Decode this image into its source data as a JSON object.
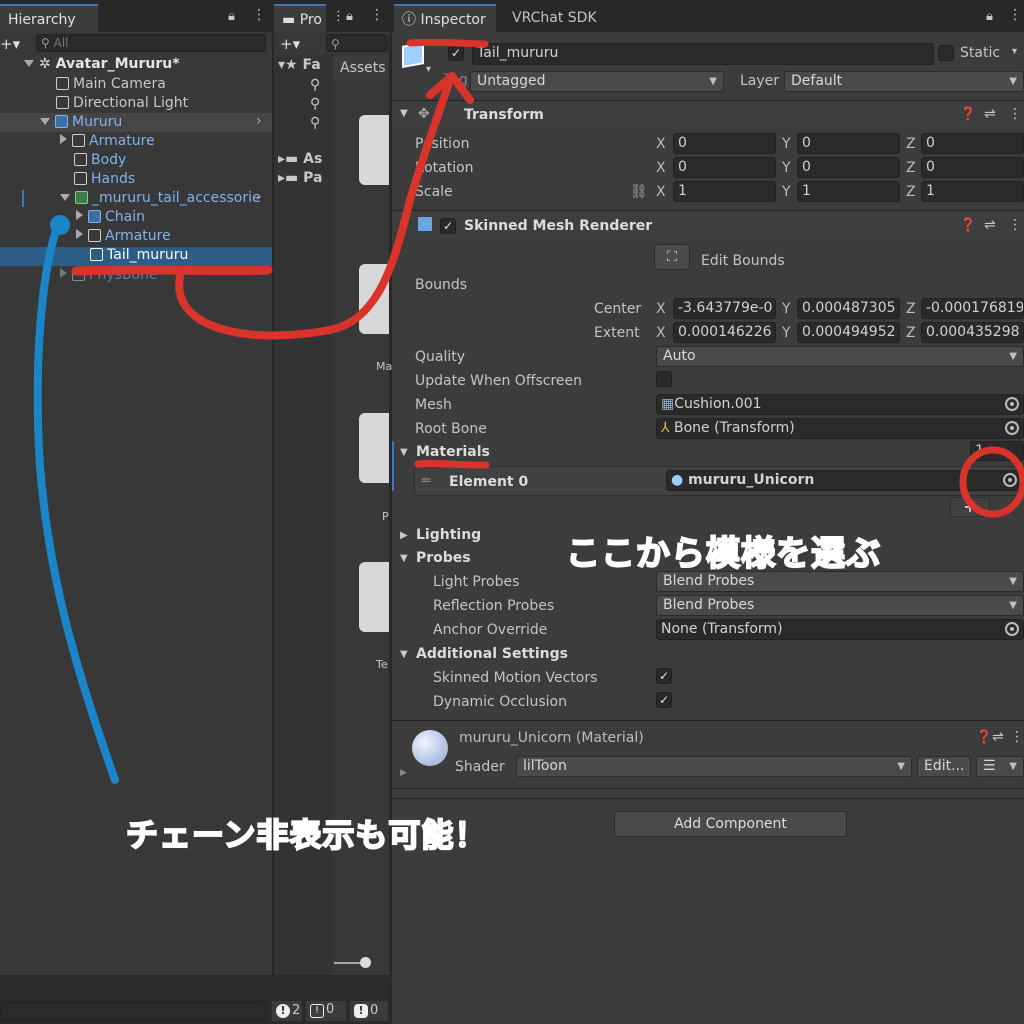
{
  "hierarchy": {
    "tab_label": "Hierarchy",
    "add_label": "+▾",
    "search_placeholder": "All",
    "root": "Avatar_Mururu*",
    "items": [
      {
        "label": "Main Camera"
      },
      {
        "label": "Directional Light"
      },
      {
        "label": "Mururu"
      },
      {
        "label": "Armature"
      },
      {
        "label": "Body"
      },
      {
        "label": "Hands"
      },
      {
        "label": "_mururu_tail_accessorie"
      },
      {
        "label": "Chain"
      },
      {
        "label": "Armature"
      },
      {
        "label": "Tail_mururu"
      },
      {
        "label": "PhysBone"
      }
    ]
  },
  "project": {
    "tab_label": "Pro",
    "add_label": "+▾",
    "assets_tab": "Assets",
    "favorites": "Fa",
    "folders": [
      "As",
      "Pa"
    ],
    "thumb_labels": [
      "Ma",
      "P",
      "Te"
    ]
  },
  "inspector": {
    "tab_label": "Inspector",
    "sdk_tab_label": "VRChat SDK",
    "object_name": "Tail_mururu",
    "static_label": "Static",
    "tag_value": "Untagged",
    "layer_label": "Layer",
    "layer_value": "Default",
    "transform": {
      "title": "Transform",
      "position_label": "Position",
      "rotation_label": "Rotation",
      "scale_label": "Scale",
      "position": [
        "0",
        "0",
        "0"
      ],
      "rotation": [
        "0",
        "0",
        "0"
      ],
      "scale": [
        "1",
        "1",
        "1"
      ]
    },
    "smr": {
      "title": "Skinned Mesh Renderer",
      "edit_bounds": "Edit Bounds",
      "bounds_label": "Bounds",
      "center_label": "Center",
      "extent_label": "Extent",
      "center": [
        "-3.643779e-0",
        "0.000487305",
        "-0.000176819"
      ],
      "extent": [
        "0.000146226",
        "0.000494952",
        "0.000435298"
      ],
      "quality_label": "Quality",
      "quality_value": "Auto",
      "update_offscreen_label": "Update When Offscreen",
      "mesh_label": "Mesh",
      "mesh_value": "Cushion.001",
      "root_bone_label": "Root Bone",
      "root_bone_value": "Bone (Transform)",
      "materials_label": "Materials",
      "materials_count": "1",
      "element0_label": "Element 0",
      "element0_value": "mururu_Unicorn",
      "lighting_label": "Lighting",
      "probes_label": "Probes",
      "light_probes_label": "Light Probes",
      "light_probes_value": "Blend Probes",
      "reflection_probes_label": "Reflection Probes",
      "reflection_probes_value": "Blend Probes",
      "anchor_override_label": "Anchor Override",
      "anchor_override_value": "None (Transform)",
      "additional_label": "Additional Settings",
      "skinned_motion_label": "Skinned Motion Vectors",
      "dynamic_occlusion_label": "Dynamic Occlusion"
    },
    "material": {
      "name": "mururu_Unicorn (Material)",
      "shader_label": "Shader",
      "shader_value": "lilToon",
      "edit_label": "Edit..."
    },
    "add_component": "Add Component"
  },
  "status": {
    "warn_count": "2",
    "info_count": "0",
    "error_count": "0"
  },
  "annotations": {
    "choose_pattern": "ここから模様を選ぶ",
    "chain_hide": "チェーン非表示も可能！"
  },
  "colors": {
    "accent": "#3a79bb",
    "selection": "#2c5d87",
    "annotation_red": "#d9342b",
    "annotation_blue": "#1a86c9"
  }
}
